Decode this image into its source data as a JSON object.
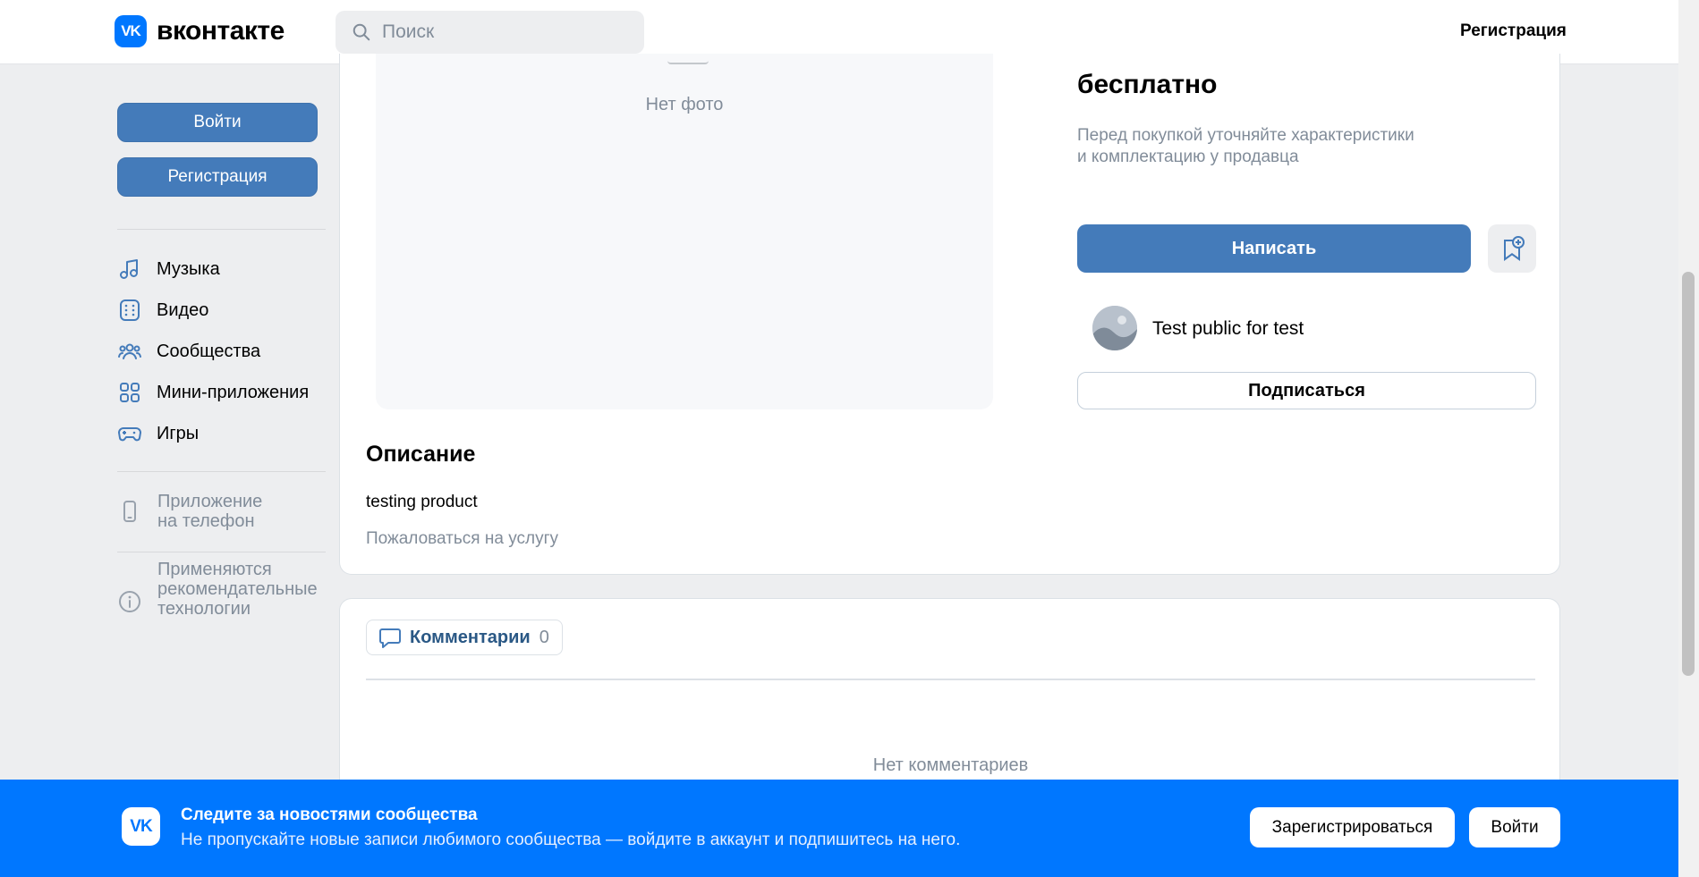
{
  "header": {
    "logo_text": "вконтакте",
    "logo_mark": "VK",
    "search_placeholder": "Поиск",
    "register_link": "Регистрация"
  },
  "sidebar": {
    "login_button": "Войти",
    "register_button": "Регистрация",
    "items": [
      {
        "label": "Музыка",
        "icon": "music-icon"
      },
      {
        "label": "Видео",
        "icon": "video-icon"
      },
      {
        "label": "Сообщества",
        "icon": "communities-icon"
      },
      {
        "label": "Мини-приложения",
        "icon": "mini-apps-icon"
      },
      {
        "label": "Игры",
        "icon": "games-icon"
      }
    ],
    "phone_app_line1": "Приложение",
    "phone_app_line2": "на телефон",
    "recommend_line1": "Применяются",
    "recommend_line2": "рекомендательные",
    "recommend_line3": "технологии"
  },
  "product": {
    "no_photo": "Нет фото",
    "price": "бесплатно",
    "note_line1": "Перед покупкой уточняйте характеристики",
    "note_line2": "и комплектацию у продавца",
    "write_button": "Написать",
    "group_name": "Test public for test",
    "subscribe_button": "Подписаться",
    "description_title": "Описание",
    "description_text": "testing product",
    "report_link": "Пожаловаться на услугу"
  },
  "comments": {
    "tab_label": "Комментарии",
    "count": "0",
    "empty_text": "Нет комментариев"
  },
  "banner": {
    "logo_mark": "VK",
    "title": "Следите за новостями сообщества",
    "text": "Не пропускайте новые записи любимого сообщества — войдите в аккаунт и подпишитесь на него.",
    "register_button": "Зарегистрироваться",
    "login_button": "Войти"
  },
  "colors": {
    "accent": "#447bba",
    "brand": "#0077ff",
    "muted": "#818c99"
  }
}
